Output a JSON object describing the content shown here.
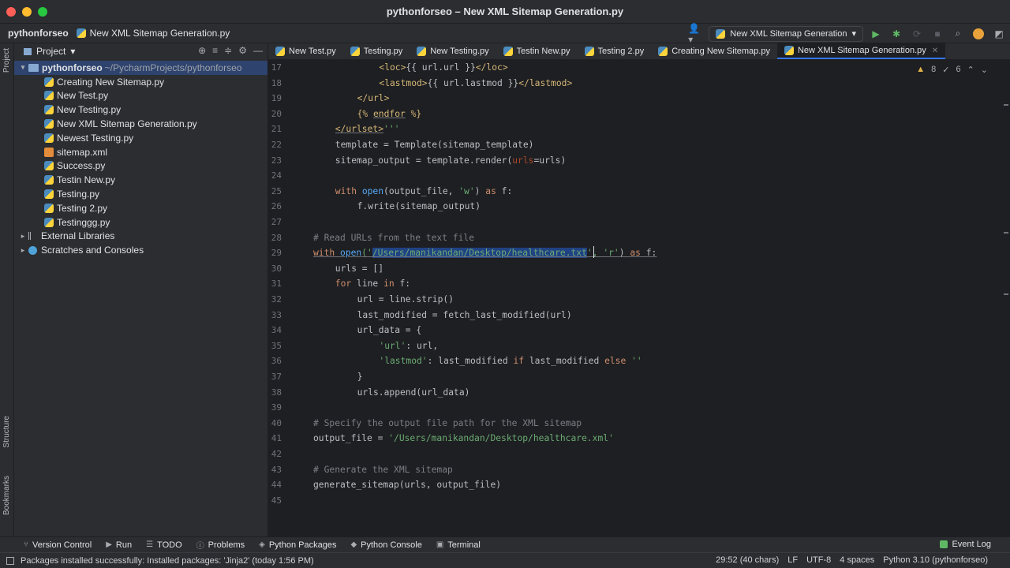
{
  "window": {
    "title": "pythonforseo – New XML Sitemap Generation.py"
  },
  "navbar": {
    "project": "pythonforseo",
    "file": "New XML Sitemap Generation.py",
    "run_config": "New XML Sitemap Generation"
  },
  "left_strip": {
    "top_label": "Project",
    "structure_label": "Structure",
    "bookmarks_label": "Bookmarks"
  },
  "project_panel": {
    "title": "Project",
    "root_name": "pythonforseo",
    "root_path": "~/PycharmProjects/pythonforseo",
    "files": [
      "Creating New Sitemap.py",
      "New Test.py",
      "New Testing.py",
      "New XML Sitemap Generation.py",
      "Newest Testing.py",
      "sitemap.xml",
      "Success.py",
      "Testin New.py",
      "Testing.py",
      "Testing 2.py",
      "Testinggg.py"
    ],
    "external_libraries": "External Libraries",
    "scratches": "Scratches and Consoles"
  },
  "tabs": [
    "New Test.py",
    "Testing.py",
    "New Testing.py",
    "Testin New.py",
    "Testing 2.py",
    "Creating New Sitemap.py",
    "New XML Sitemap Generation.py"
  ],
  "inspections": {
    "warnings": "8",
    "weak_warnings": "6"
  },
  "line_numbers": [
    "17",
    "18",
    "19",
    "20",
    "21",
    "22",
    "23",
    "24",
    "25",
    "26",
    "27",
    "28",
    "29",
    "30",
    "31",
    "32",
    "33",
    "34",
    "35",
    "36",
    "37",
    "38",
    "39",
    "40",
    "41",
    "42",
    "43",
    "44",
    "45"
  ],
  "code": {
    "l17_a": "<loc>",
    "l17_b": "{{ url.url }}",
    "l17_c": "</loc>",
    "l18_a": "<lastmod>",
    "l18_b": "{{ url.lastmod }}",
    "l18_c": "</lastmod>",
    "l19_a": "</url>",
    "l20_a": "{% ",
    "l20_b": "endfor",
    "l20_c": " %}",
    "l21_a": "</urlset>",
    "l21_b": "'''",
    "l22": "template = Template(sitemap_template)",
    "l23_a": "sitemap_output = template.render(",
    "l23_b": "urls",
    "l23_c": "=urls)",
    "l25_a": "with ",
    "l25_b": "open",
    "l25_c": "(output_file, ",
    "l25_d": "'w'",
    "l25_e": ") ",
    "l25_f": "as ",
    "l25_g": "f:",
    "l26": "f.write(sitemap_output)",
    "l28": "# Read URLs from the text file",
    "l29_a": "with ",
    "l29_b": "open",
    "l29_c": "('",
    "l29_d": "/Users/manikandan/Desktop/healthcare.txt",
    "l29_e": "', ",
    "l29_f": "'r'",
    "l29_g": ") ",
    "l29_h": "as ",
    "l29_i": "f:",
    "l30": "urls = []",
    "l31_a": "for ",
    "l31_b": "line ",
    "l31_c": "in ",
    "l31_d": "f:",
    "l32": "url = line.strip()",
    "l33": "last_modified = fetch_last_modified(url)",
    "l34": "url_data = {",
    "l35_a": "'url'",
    "l35_b": ": url,",
    "l36_a": "'lastmod'",
    "l36_b": ": last_modified ",
    "l36_c": "if ",
    "l36_d": "last_modified ",
    "l36_e": "else ",
    "l36_f": "''",
    "l37": "}",
    "l38": "urls.append(url_data)",
    "l40": "# Specify the output file path for the XML sitemap",
    "l41_a": "output_file = ",
    "l41_b": "'/Users/manikandan/Desktop/healthcare.xml'",
    "l43": "# Generate the XML sitemap",
    "l44": "generate_sitemap(urls, output_file)"
  },
  "toolwindows": {
    "version_control": "Version Control",
    "run": "Run",
    "todo": "TODO",
    "problems": "Problems",
    "python_packages": "Python Packages",
    "python_console": "Python Console",
    "terminal": "Terminal",
    "event_log": "Event Log"
  },
  "status": {
    "message": "Packages installed successfully: Installed packages: 'Jinja2' (today 1:56 PM)",
    "position": "29:52 (40 chars)",
    "line_sep": "LF",
    "encoding": "UTF-8",
    "indent": "4 spaces",
    "interpreter": "Python 3.10 (pythonforseo)"
  },
  "colors": {
    "accent": "#3574f0",
    "keyword": "#cf8e6d",
    "string": "#6aab73",
    "comment": "#7a7e85",
    "selection": "#214283"
  }
}
